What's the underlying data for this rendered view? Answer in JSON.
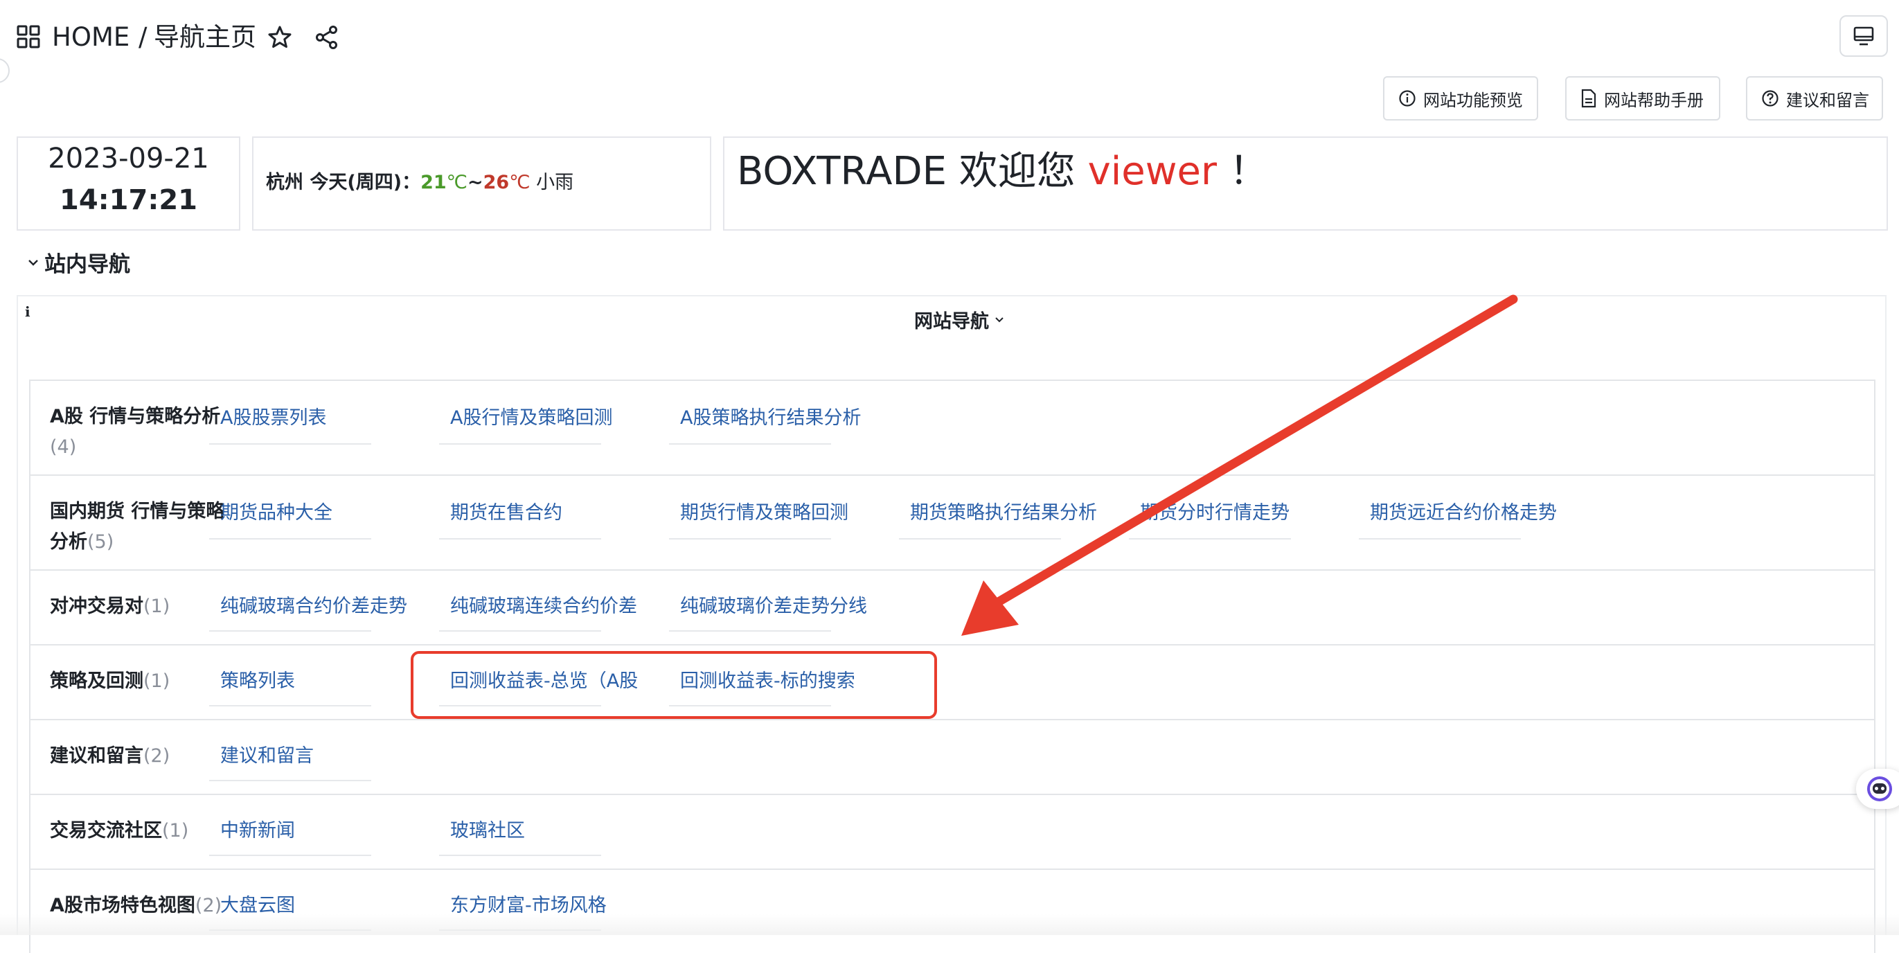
{
  "header": {
    "home_label": "HOME",
    "separator": "/",
    "page_title": "导航主页"
  },
  "toolbar": {
    "preview_label": "网站功能预览",
    "manual_label": "网站帮助手册",
    "feedback_label": "建议和留言"
  },
  "datetime": {
    "date": "2023-09-21",
    "time": "14:17:21"
  },
  "weather": {
    "prefix": "杭州 今天(周四)：",
    "low": "21",
    "low_unit": "℃",
    "tilde": "~",
    "high": "26",
    "high_unit": "℃",
    "condition": "小雨",
    "colors": {
      "low": "#4a9a2a",
      "high": "#c0392b"
    }
  },
  "welcome": {
    "text": "BOXTRADE 欢迎您 ",
    "user": "viewer",
    "suffix": "！",
    "user_color": "#e0302a"
  },
  "section": {
    "title": "站内导航"
  },
  "nav_panel": {
    "info_glyph": "i",
    "title": "网站导航"
  },
  "nav": {
    "rows": [
      {
        "category": "A股 行情与策略分析",
        "count": "(4)",
        "links": [
          "A股股票列表",
          "A股行情及策略回测",
          "A股策略执行结果分析"
        ]
      },
      {
        "category": "国内期货 行情与策略分析",
        "count": "(5)",
        "links": [
          "期货品种大全",
          "期货在售合约",
          "期货行情及策略回测",
          "期货策略执行结果分析",
          "期货分时行情走势",
          "期货远近合约价格走势"
        ]
      },
      {
        "category": "对冲交易对",
        "count": "(1)",
        "links": [
          "纯碱玻璃合约价差走势",
          "纯碱玻璃连续合约价差",
          "纯碱玻璃价差走势分线"
        ]
      },
      {
        "category": "策略及回测",
        "count": "(1)",
        "links": [
          "策略列表",
          "回测收益表-总览（A股",
          "回测收益表-标的搜索"
        ]
      },
      {
        "category": "建议和留言",
        "count": "(2)",
        "links": [
          "建议和留言"
        ]
      },
      {
        "category": "交易交流社区",
        "count": "(1)",
        "links": [
          "中新新闻",
          "玻璃社区"
        ]
      },
      {
        "category": "A股市场特色视图",
        "count": "(2)",
        "links": [
          "大盘云图",
          "东方财富-市场风格"
        ]
      }
    ]
  },
  "annotation": {
    "arrow_color": "#e83c2c",
    "box_color": "#e83c2c"
  }
}
